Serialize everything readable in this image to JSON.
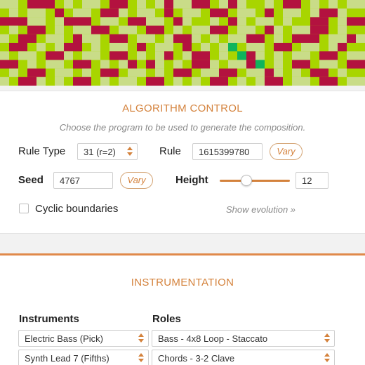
{
  "pattern": {
    "colors": {
      "background": "#a8d500",
      "light": "#c9dc88",
      "red": "#b3123f",
      "green": "#0fb45c"
    },
    "rows": [
      "LL.RRR.L.LL.RR.L.LRLLRR.LRL..L.RR.L.L.L",
      ".L.LL.R.LL.RRL.LL.R.LL.RR.LL.R.LL.LRRL.",
      "RRRLL.LRRR.LL.RRLL.RL..L.RL.LL.L..RR.LR",
      ".L.RR.L.LLRR.LL.RR.L.LLRR.LL.RL.LLRR.L.",
      "L.RR.LL.RLL.RR.LL.LRRL.L.LLRR.L.RRR.LLR",
      ".RR.L.LRR.L.LL.R.LL.R.L.LG.LL.RR.LL.LR.",
      "L.LL.RRL.LL.RR.L.LR.LRR.L.GRL.L.LL.RR.L",
      "RR.L.LL.RR.L.LR.RL.L.RRL.LLRG.L.RR.LL.R",
      ".L.RR.LL.L.RR.LL.L.RR.LLRR.LLRL.L.RR.L.",
      "L.RRL.L.RR.L.LL.RR.L.L.RR.L.LRR.LL.RR.L"
    ]
  },
  "algorithm": {
    "title": "ALGORITHM CONTROL",
    "subtitle": "Choose the program to be used to generate the composition.",
    "rule_type_label": "Rule Type",
    "rule_type_value": "31 (r=2)",
    "rule_label": "Rule",
    "rule_value": "1615399780",
    "vary_label": "Vary",
    "seed_label": "Seed",
    "seed_value": "4767",
    "height_label": "Height",
    "height_value": "12",
    "height_level": 0.38,
    "cyclic_label": "Cyclic boundaries",
    "show_evolution": "Show evolution »"
  },
  "instrumentation": {
    "title": "INSTRUMENTATION",
    "instruments_label": "Instruments",
    "roles_label": "Roles",
    "rows": [
      {
        "instrument": "Electric Bass (Pick)",
        "role": "Bass - 4x8 Loop - Staccato"
      },
      {
        "instrument": "Synth Lead 7 (Fifths)",
        "role": "Chords - 3-2 Clave"
      }
    ]
  }
}
